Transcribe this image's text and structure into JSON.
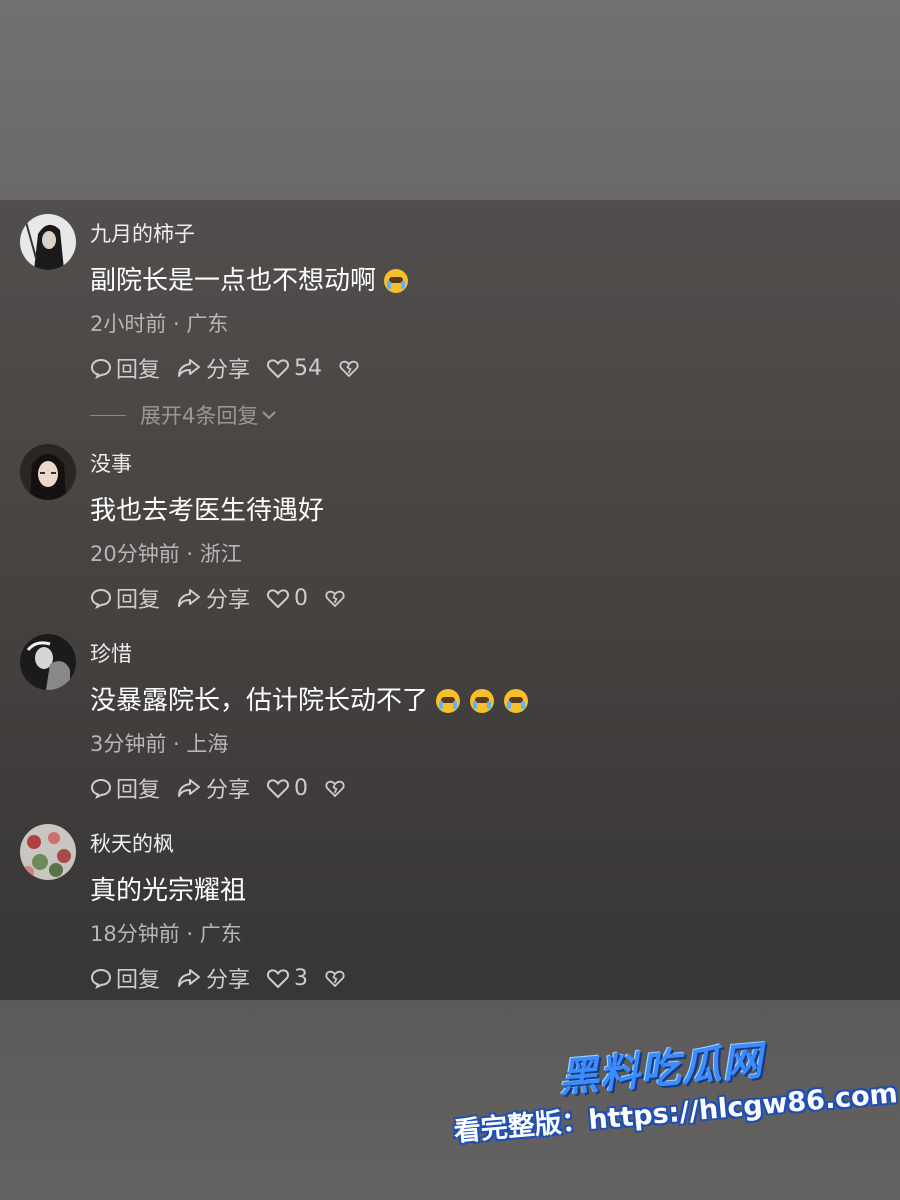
{
  "comments": [
    {
      "username": "九月的柿子",
      "text": "副院长是一点也不想动啊",
      "emoji_count": 1,
      "emoji_name": "grimace-emoji",
      "time_location": "2小时前 · 广东",
      "reply_label": "回复",
      "share_label": "分享",
      "likes": "54",
      "expand_label": "展开4条回复"
    },
    {
      "username": "没事",
      "text": "我也去考医生待遇好",
      "emoji_count": 0,
      "time_location": "20分钟前 · 浙江",
      "reply_label": "回复",
      "share_label": "分享",
      "likes": "0"
    },
    {
      "username": "珍惜",
      "text": "没暴露院长，估计院长动不了",
      "emoji_count": 3,
      "emoji_name": "crying-laughing-emoji",
      "time_location": "3分钟前 · 上海",
      "reply_label": "回复",
      "share_label": "分享",
      "likes": "0"
    },
    {
      "username": "秋天的枫",
      "text": "真的光宗耀祖",
      "emoji_count": 0,
      "time_location": "18分钟前 · 广东",
      "reply_label": "回复",
      "share_label": "分享",
      "likes": "3"
    }
  ],
  "watermark": {
    "title": "黑料吃瓜网",
    "url_line": "看完整版：https://hlcgw86.com"
  },
  "colors": {
    "watermark_blue": "#3a8cff",
    "emoji_yellow": "#f6c02c"
  }
}
